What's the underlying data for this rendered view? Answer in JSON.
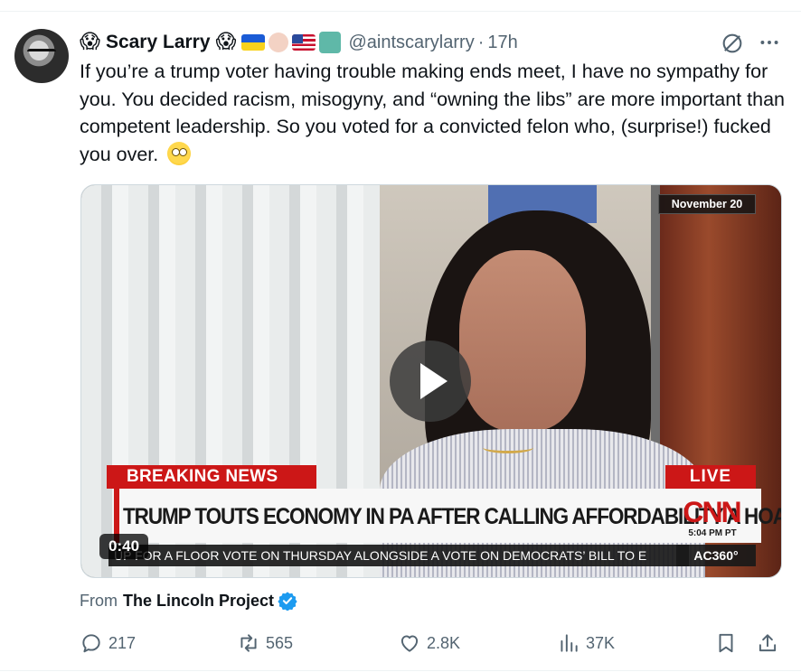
{
  "tweet": {
    "author": {
      "display_name": "Scary Larry",
      "handle": "@aintscarylarry",
      "leading_emoji": "😱",
      "trailing_emoji": "😱",
      "badge_icons": [
        "ukraine-flag-icon",
        "raised-fist-icon",
        "us-flag-icon",
        "statue-of-liberty-icon"
      ]
    },
    "separator": "·",
    "time_ago": "17h",
    "text": "If you’re a trump voter having trouble making ends meet, I have no sympathy for you. You decided racism, misogyny, and “owning the libs” are more important than competent leadership. So you voted for a convicted felon who, (surprise!) fucked you over.",
    "text_emoji": "face-with-rolling-eyes-icon"
  },
  "media": {
    "date_badge": "November 20",
    "chyron_label": "BREAKING NEWS",
    "live_label": "LIVE",
    "headline": "TRUMP TOUTS ECONOMY IN PA AFTER CALLING AFFORDABILITY A HOAX",
    "network_logo": "CNN",
    "time_stamp": "5:04 PM PT",
    "ticker": "UP FOR A FLOOR VOTE ON THURSDAY ALONGSIDE A VOTE ON DEMOCRATS’ BILL TO E",
    "show_tag": "AC360°",
    "duration": "0:40"
  },
  "source": {
    "prefix": "From",
    "name": "The Lincoln Project"
  },
  "actions": {
    "replies": "217",
    "reposts": "565",
    "likes": "2.8K",
    "views": "37K"
  },
  "colors": {
    "text_primary": "#0f1419",
    "text_secondary": "#536471",
    "verified_blue": "#1d9bf0",
    "cnn_red": "#cc1717"
  }
}
